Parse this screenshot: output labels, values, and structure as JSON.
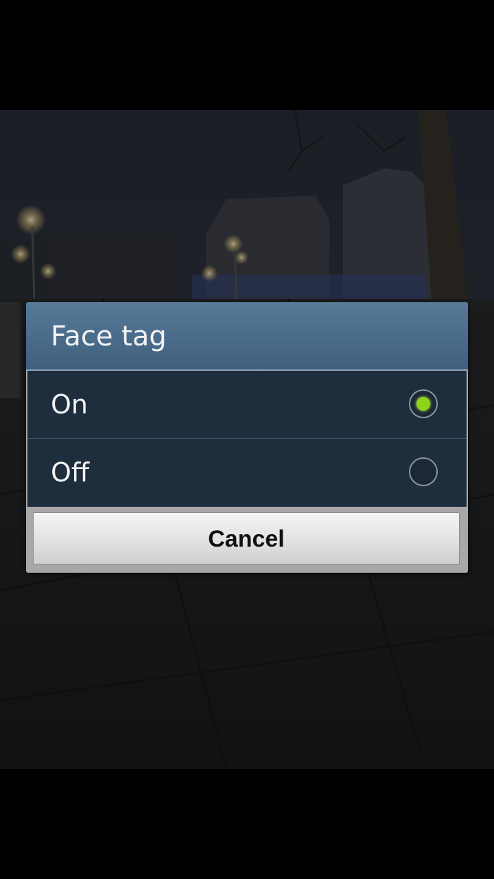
{
  "dialog": {
    "title": "Face tag",
    "options": [
      {
        "label": "On",
        "selected": true
      },
      {
        "label": "Off",
        "selected": false
      }
    ],
    "cancel_label": "Cancel"
  },
  "colors": {
    "title_bar": "#4a6d8d",
    "options_bg": "#1f2e3d",
    "radio_selected": "#8fd21c"
  }
}
